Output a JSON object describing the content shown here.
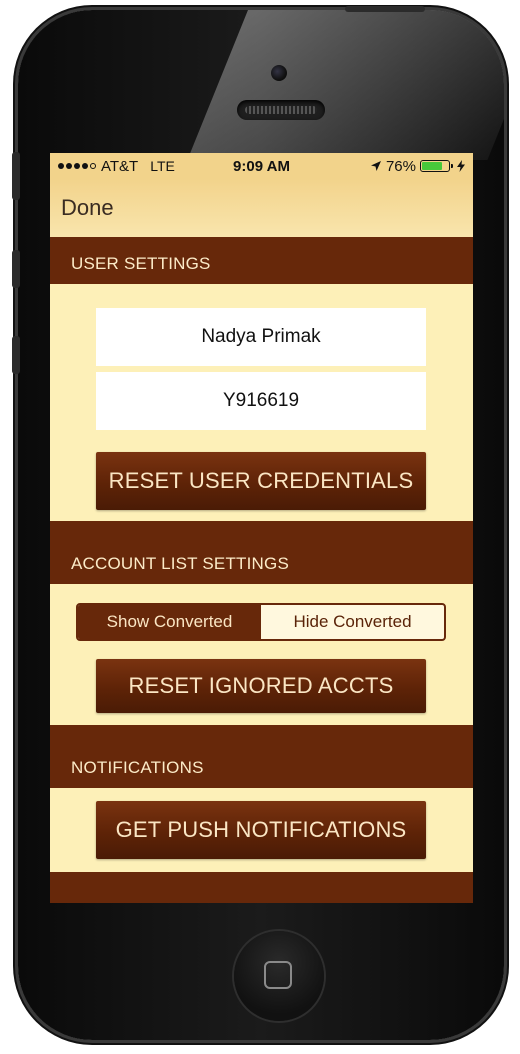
{
  "status_bar": {
    "carrier": "AT&T",
    "network": "LTE",
    "time": "9:09 AM",
    "battery_percent": "76%",
    "battery_level": 0.76,
    "signal_bars_filled": 4,
    "signal_bars_total": 5
  },
  "nav": {
    "done_label": "Done"
  },
  "user_settings": {
    "header": "USER SETTINGS",
    "name_value": "Nadya Primak",
    "id_value": "Y916619",
    "reset_label": "RESET USER CREDENTIALS"
  },
  "account_list_settings": {
    "header": "ACCOUNT LIST SETTINGS",
    "segments": [
      "Show Converted",
      "Hide Converted"
    ],
    "selected_segment": "Show Converted",
    "reset_label": "RESET IGNORED ACCTS"
  },
  "notifications": {
    "header": "NOTIFICATIONS",
    "push_label": "GET PUSH NOTIFICATIONS"
  },
  "colors": {
    "header_brown": "#67280a",
    "body_cream": "#fdf0b8",
    "nav_gold": "#f2d38b",
    "button_text": "#fbe6c4",
    "battery_green": "#47c83a"
  }
}
